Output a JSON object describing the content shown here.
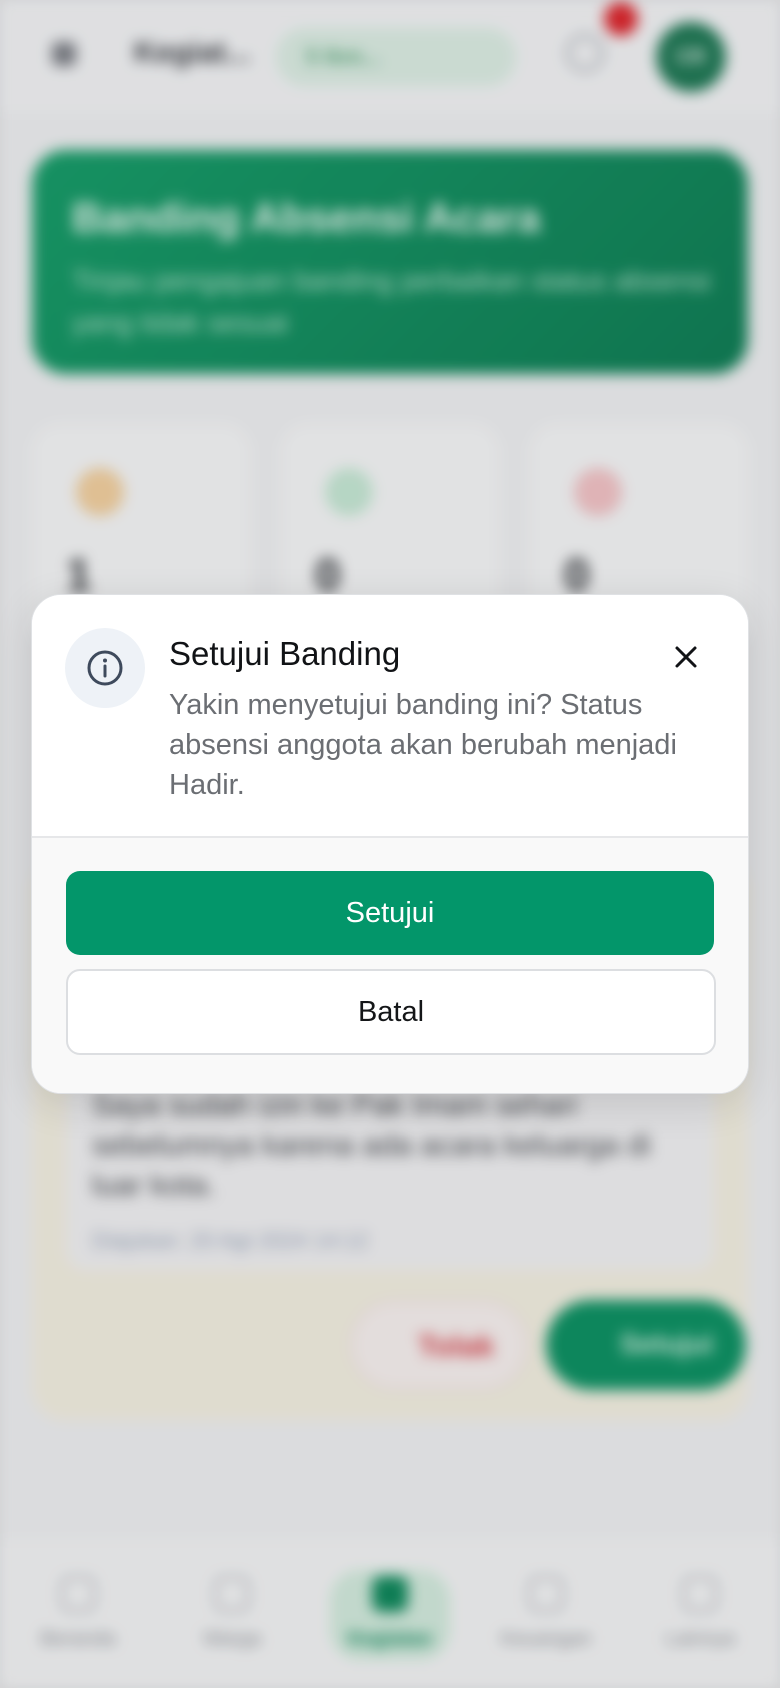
{
  "background": {
    "topbar": {
      "title": "Kegiat...",
      "org_chip": "5 Ikm...",
      "avatar_initials": "CR"
    },
    "hero": {
      "title": "Banding Absensi Acara",
      "subtitle": "Tinjau pengajuan banding perbaikan status absensi yang tidak sesuai"
    },
    "stats": [
      {
        "value": "1",
        "color": "#f3b04b"
      },
      {
        "value": "0",
        "color": "#7ad19d"
      },
      {
        "value": "0",
        "color": "#ef6a70"
      }
    ],
    "appeal": {
      "reason": "Saya sudah izin ke Pak Imam sehari sebelumnya karena ada acara keluarga di luar kota.",
      "meta": "Diajukan: 20 Agt 2024 14:12",
      "reject_label": "Tolak",
      "approve_label": "Setujui"
    },
    "bottom_nav": [
      {
        "label": "Beranda",
        "active": false
      },
      {
        "label": "Warga",
        "active": false
      },
      {
        "label": "Kegiatan",
        "active": true
      },
      {
        "label": "Keuangan",
        "active": false
      },
      {
        "label": "Lainnya",
        "active": false
      }
    ]
  },
  "dialog": {
    "title": "Setujui Banding",
    "message": "Yakin menyetujui banding ini? Status absensi anggota akan berubah menjadi Hadir.",
    "confirm_label": "Setujui",
    "cancel_label": "Batal",
    "icon": "info-icon",
    "close_icon": "close-icon"
  },
  "colors": {
    "primary": "#03966a",
    "icon_badge_bg": "#eef2f7",
    "icon_stroke": "#3e4a5c"
  }
}
